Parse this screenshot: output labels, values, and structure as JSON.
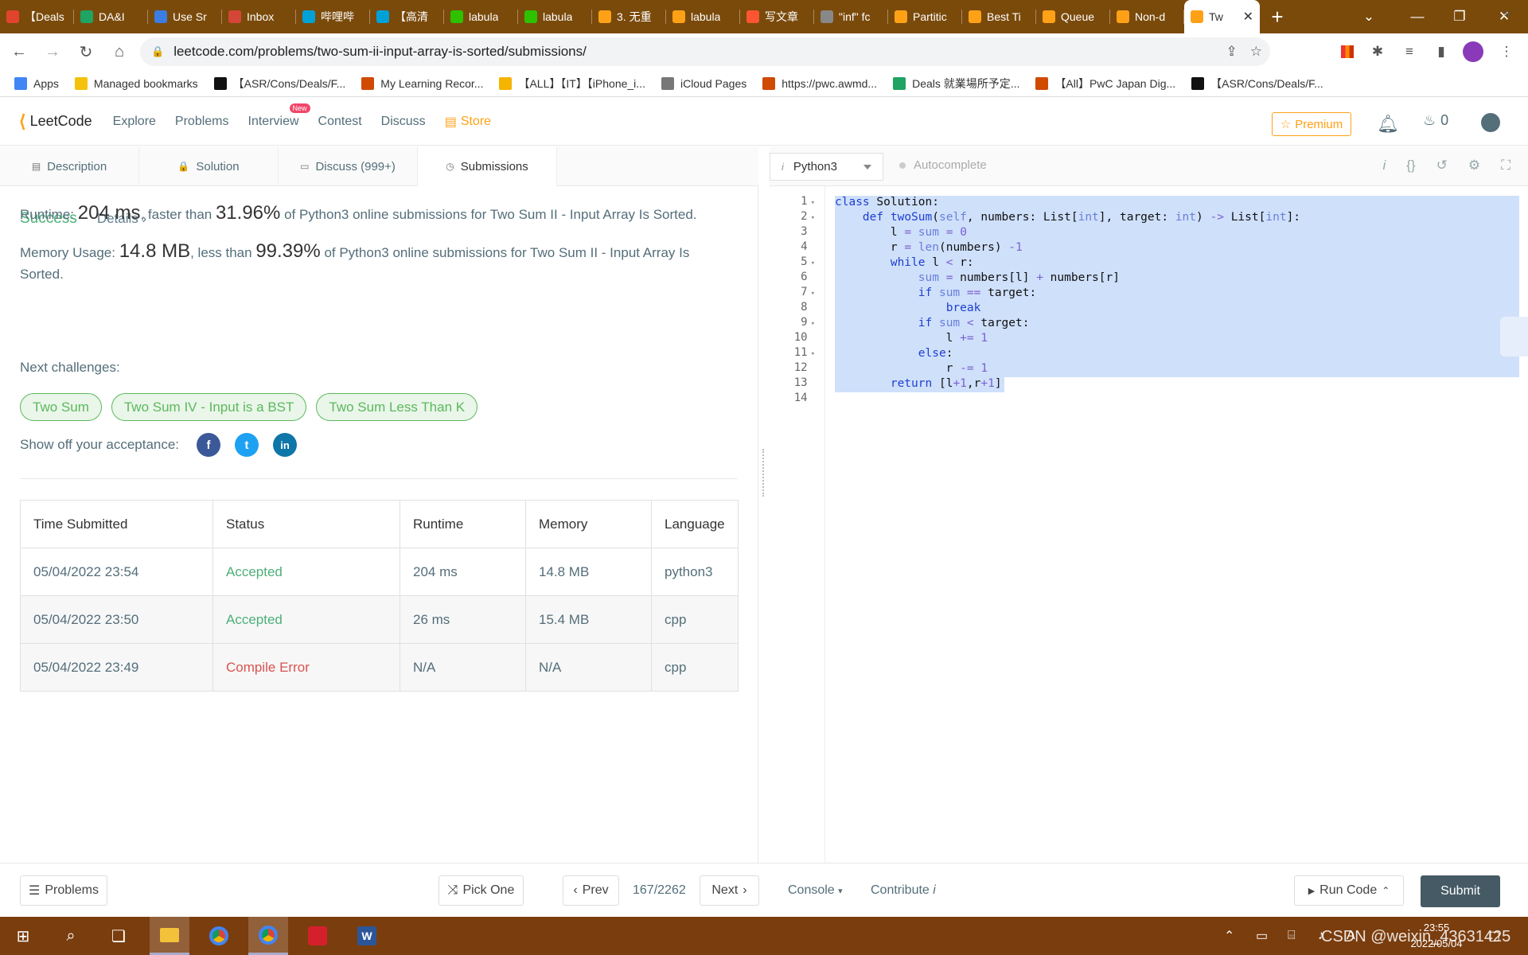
{
  "browser": {
    "tabs": [
      {
        "label": "【Deals",
        "color": "#e1442d"
      },
      {
        "label": "DA&I",
        "color": "#1fa463"
      },
      {
        "label": "Use Sr",
        "color": "#3b7de0"
      },
      {
        "label": "Inbox",
        "color": "#d44638"
      },
      {
        "label": "哔哩哔",
        "color": "#00a1d6"
      },
      {
        "label": "【高清",
        "color": "#00a1d6"
      },
      {
        "label": "labula",
        "color": "#2dc100"
      },
      {
        "label": "labula",
        "color": "#2dc100"
      },
      {
        "label": "3. 无重",
        "color": "#ffa116"
      },
      {
        "label": "labula",
        "color": "#ffa116"
      },
      {
        "label": "写文章",
        "color": "#fc5531"
      },
      {
        "label": "\"inf\" fc",
        "color": "#888888"
      },
      {
        "label": "Partitic",
        "color": "#ffa116"
      },
      {
        "label": "Best Ti",
        "color": "#ffa116"
      },
      {
        "label": "Queue",
        "color": "#ffa116"
      },
      {
        "label": "Non-d",
        "color": "#ffa116"
      }
    ],
    "active_tab": {
      "label": "Tw",
      "color": "#ffa116"
    },
    "url": "leetcode.com/problems/two-sum-ii-input-array-is-sorted/submissions/"
  },
  "bookmarks": [
    {
      "label": "Apps",
      "color": "#4285f4"
    },
    {
      "label": "Managed bookmarks",
      "color": "#f4c20d"
    },
    {
      "label": "【ASR/Cons/Deals/F...",
      "color": "#111111"
    },
    {
      "label": "My Learning Recor...",
      "color": "#d04a02"
    },
    {
      "label": "【ALL】【IT】【iPhone_i...",
      "color": "#f4b400"
    },
    {
      "label": "iCloud Pages",
      "color": "#777777"
    },
    {
      "label": "https://pwc.awmd...",
      "color": "#d04a02"
    },
    {
      "label": "Deals 就業場所予定...",
      "color": "#1fa463"
    },
    {
      "label": "【All】PwC Japan Dig...",
      "color": "#d04a02"
    },
    {
      "label": "【ASR/Cons/Deals/F...",
      "color": "#111111"
    }
  ],
  "leetcode": {
    "logo_text": "LeetCode",
    "nav": [
      "Explore",
      "Problems",
      "Interview",
      "Contest",
      "Discuss"
    ],
    "new_badge": "New",
    "store": "Store",
    "premium": "Premium",
    "streak": "0"
  },
  "left_tabs": [
    {
      "label": "Description",
      "icon": "description-icon"
    },
    {
      "label": "Solution",
      "icon": "lock-icon"
    },
    {
      "label": "Discuss (999+)",
      "icon": "discuss-icon"
    },
    {
      "label": "Submissions",
      "icon": "clock-icon"
    }
  ],
  "result": {
    "status": "Success",
    "details": "Details",
    "runtime_prefix": "Runtime: ",
    "runtime_value": "204 ms",
    "runtime_mid": ", faster than ",
    "runtime_pct": "31.96%",
    "runtime_suffix": " of Python3 online submissions for Two Sum II - Input Array Is Sorted.",
    "memory_prefix": "Memory Usage: ",
    "memory_value": "14.8 MB",
    "memory_mid": ", less than ",
    "memory_pct": "99.39%",
    "memory_suffix": " of Python3 online submissions for Two Sum II - Input Array Is Sorted.",
    "next_label": "Next challenges:",
    "challenges": [
      "Two Sum",
      "Two Sum IV - Input is a BST",
      "Two Sum Less Than K"
    ],
    "share_label": "Show off your acceptance:"
  },
  "submissions": {
    "headers": [
      "Time Submitted",
      "Status",
      "Runtime",
      "Memory",
      "Language"
    ],
    "rows": [
      [
        "05/04/2022 23:54",
        "Accepted",
        "204 ms",
        "14.8 MB",
        "python3"
      ],
      [
        "05/04/2022 23:50",
        "Accepted",
        "26 ms",
        "15.4 MB",
        "cpp"
      ],
      [
        "05/04/2022 23:49",
        "Compile Error",
        "N/A",
        "N/A",
        "cpp"
      ]
    ]
  },
  "editor": {
    "language": "Python3",
    "autocomplete": "Autocomplete",
    "line_numbers": [
      "1",
      "2",
      "3",
      "4",
      "5",
      "6",
      "7",
      "8",
      "9",
      "10",
      "11",
      "12",
      "13",
      "14"
    ],
    "folded_lines": [
      1,
      2,
      5,
      7,
      9,
      11
    ]
  },
  "bottom": {
    "problems": "Problems",
    "pick_one": "Pick One",
    "prev": "Prev",
    "counter": "167/2262",
    "next": "Next",
    "console": "Console",
    "contribute": "Contribute",
    "run_code": "Run Code",
    "submit": "Submit"
  },
  "taskbar": {
    "time": "23:55",
    "date": "2022/05/04",
    "watermark": "CSDN @weixin_43631425"
  }
}
